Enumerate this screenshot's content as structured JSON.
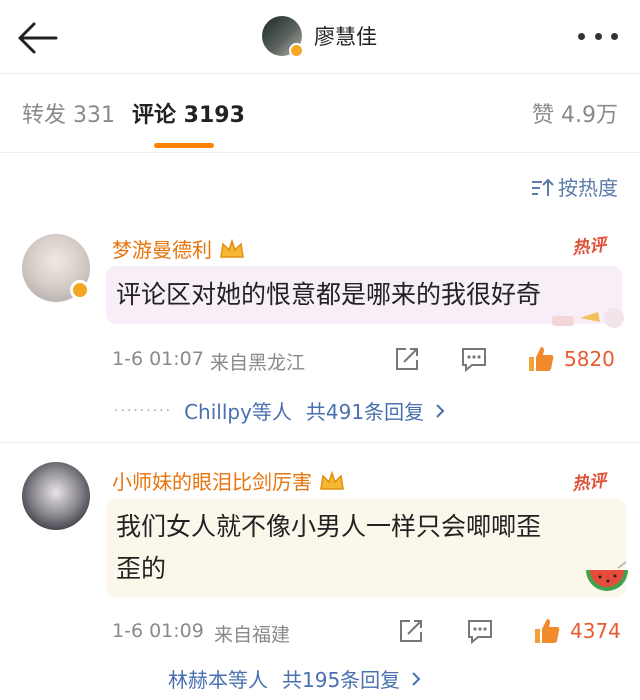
{
  "header": {
    "name": "廖慧佳",
    "back_icon": "arrow-left-icon",
    "more_icon": "more-dots-icon"
  },
  "tabs": [
    {
      "label": "转发 331"
    },
    {
      "label": "评论 3193",
      "active": true
    },
    {
      "label": "赞 4.9万"
    }
  ],
  "sort": {
    "label": "按热度"
  },
  "comments": [
    {
      "user": "梦游曼德利",
      "badge": "热评",
      "text": "评论区对她的恨意都是哪来的我很好奇",
      "time": "1-6 01:07",
      "location": "来自黑龙江",
      "likes": "5820",
      "reply_names": "Chillpy等人",
      "reply_count": "共491条回复"
    },
    {
      "user": "小师妹的眼泪比剑厉害",
      "badge": "热评",
      "text_line1": "我们女人就不像小男人一样只会唧唧歪",
      "text_line2": "歪的",
      "time": "1-6 01:09",
      "location": "来自福建",
      "likes": "4374",
      "reply_names": "林赫本等人",
      "reply_count": "共195条回复"
    }
  ],
  "colors": {
    "accent": "#ff8200",
    "username": "#e8740c",
    "link": "#4a70b0",
    "like": "#e85a32"
  }
}
